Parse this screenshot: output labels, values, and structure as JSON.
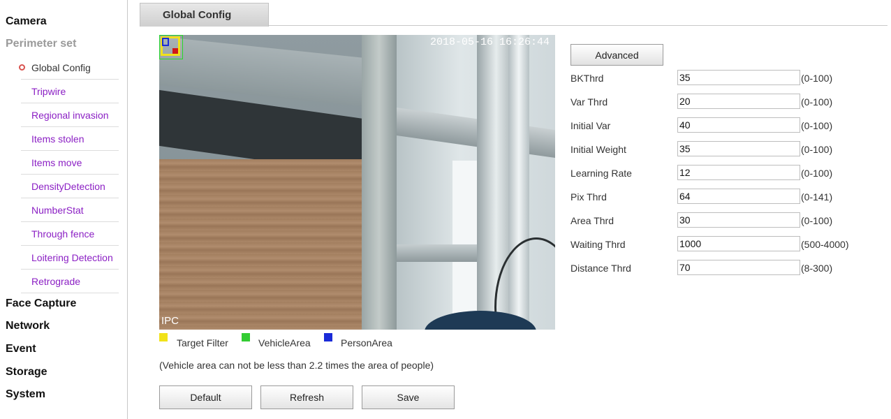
{
  "sidebar": {
    "camera": "Camera",
    "perimeter": "Perimeter set",
    "sub_items": [
      {
        "label": "Global Config",
        "active": true
      },
      {
        "label": "Tripwire"
      },
      {
        "label": "Regional invasion"
      },
      {
        "label": "Items stolen"
      },
      {
        "label": "Items move"
      },
      {
        "label": "DensityDetection"
      },
      {
        "label": "NumberStat"
      },
      {
        "label": "Through fence"
      },
      {
        "label": "Loitering Detection"
      },
      {
        "label": "Retrograde"
      }
    ],
    "face_capture": "Face Capture",
    "network": "Network",
    "event": "Event",
    "storage": "Storage",
    "system": "System"
  },
  "tab": {
    "label": "Global Config"
  },
  "video": {
    "timestamp": "2018-05-16 16:26:44",
    "channel": "IPC"
  },
  "legend": {
    "items": [
      {
        "label": "Target Filter",
        "color": "#f1e21a"
      },
      {
        "label": "VehicleArea",
        "color": "#33cc33"
      },
      {
        "label": "PersonArea",
        "color": "#1a2bd8"
      }
    ],
    "note": "(Vehicle area can not be less than 2.2 times the area of people)"
  },
  "buttons": {
    "default": "Default",
    "refresh": "Refresh",
    "save": "Save",
    "advanced": "Advanced"
  },
  "params": [
    {
      "label": "BKThrd",
      "value": "35",
      "range": "(0-100)"
    },
    {
      "label": "Var Thrd",
      "value": "20",
      "range": "(0-100)"
    },
    {
      "label": "Initial Var",
      "value": "40",
      "range": "(0-100)"
    },
    {
      "label": "Initial Weight",
      "value": "35",
      "range": "(0-100)"
    },
    {
      "label": "Learning Rate",
      "value": "12",
      "range": "(0-100)"
    },
    {
      "label": "Pix Thrd",
      "value": "64",
      "range": "(0-141)"
    },
    {
      "label": "Area Thrd",
      "value": "30",
      "range": "(0-100)"
    },
    {
      "label": "Waiting Thrd",
      "value": "1000",
      "range": "(500-4000)"
    },
    {
      "label": "Distance Thrd",
      "value": "70",
      "range": "(8-300)"
    }
  ]
}
